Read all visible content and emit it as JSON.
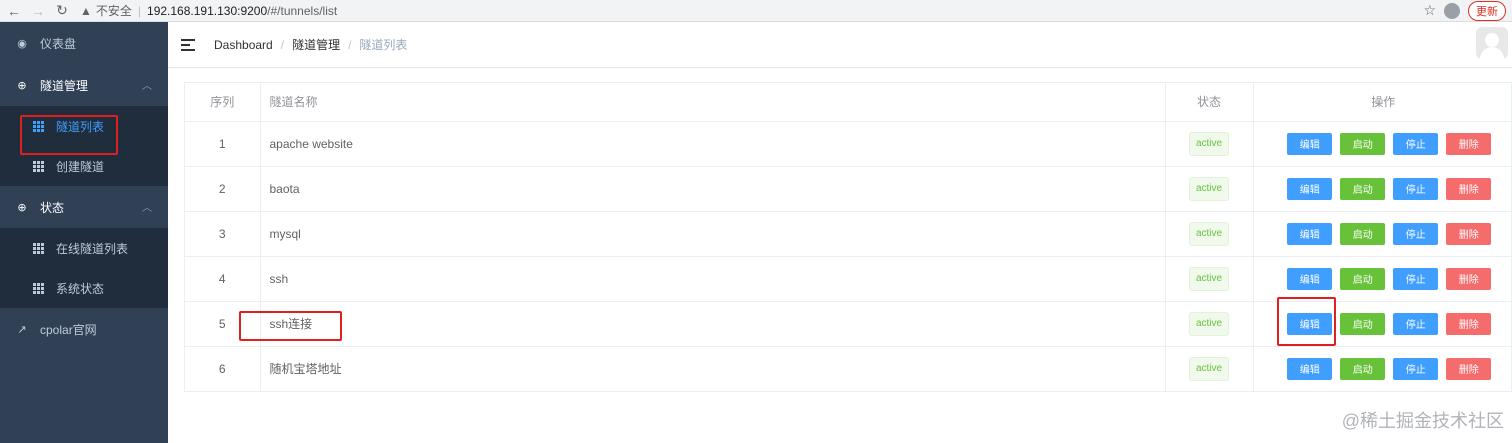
{
  "browser": {
    "insecure_label": "不安全",
    "url_host": "192.168.191.130:9200",
    "url_path": "/#/tunnels/list",
    "update_label": "更新"
  },
  "sidebar": {
    "items": [
      {
        "label": "仪表盘",
        "icon": "dashboard-icon"
      },
      {
        "label": "隧道管理",
        "icon": "plus-circle-icon",
        "children": [
          {
            "label": "隧道列表",
            "icon": "grid-icon",
            "active": true
          },
          {
            "label": "创建隧道",
            "icon": "grid-icon"
          }
        ]
      },
      {
        "label": "状态",
        "icon": "plus-circle-icon",
        "children": [
          {
            "label": "在线隧道列表",
            "icon": "grid-icon"
          },
          {
            "label": "系统状态",
            "icon": "grid-icon"
          }
        ]
      },
      {
        "label": "cpolar官网",
        "icon": "external-link-icon"
      }
    ]
  },
  "breadcrumb": [
    "Dashboard",
    "隧道管理",
    "隧道列表"
  ],
  "table": {
    "headers": {
      "index": "序列",
      "name": "隧道名称",
      "status": "状态",
      "ops": "操作"
    },
    "rows": [
      {
        "index": "1",
        "name": "apache website",
        "status": "active"
      },
      {
        "index": "2",
        "name": "baota",
        "status": "active"
      },
      {
        "index": "3",
        "name": "mysql",
        "status": "active"
      },
      {
        "index": "4",
        "name": "ssh",
        "status": "active"
      },
      {
        "index": "5",
        "name": "ssh连接",
        "status": "active"
      },
      {
        "index": "6",
        "name": "随机宝塔地址",
        "status": "active"
      }
    ],
    "buttons": {
      "edit": "编辑",
      "start": "启动",
      "stop": "停止",
      "delete": "删除"
    }
  },
  "watermark": "@稀土掘金技术社区",
  "colors": {
    "sidebar_bg": "#304156",
    "primary": "#409eff",
    "success": "#67c23a",
    "danger": "#f56c6c"
  }
}
